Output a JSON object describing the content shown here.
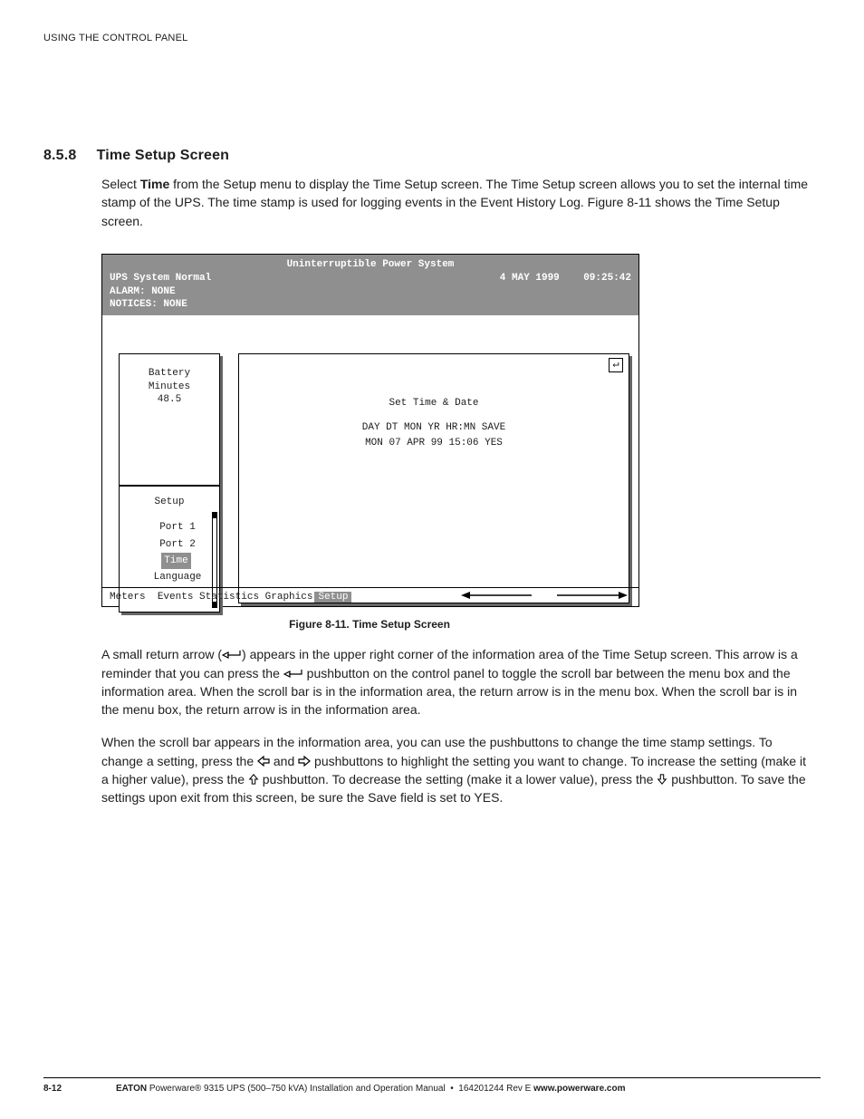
{
  "running_head": "USING THE CONTROL PANEL",
  "section": {
    "num": "8.5.8",
    "title": "Time Setup Screen"
  },
  "intro": {
    "p1a": "Select ",
    "p1_bold": "Time",
    "p1b": " from the Setup menu to display the Time Setup screen. The Time Setup screen allows you to set the internal time stamp of the UPS. The time stamp is used for logging events in the Event History Log. Figure 8-11 shows the Time Setup screen."
  },
  "lcd": {
    "title": "Uninterruptible Power System",
    "status_left": "UPS System Normal",
    "date": "4 MAY 1999",
    "time": "09:25:42",
    "alarm": "ALARM:   NONE",
    "notices": "NOTICES: NONE",
    "battery": {
      "l1": "Battery",
      "l2": "Minutes",
      "l3": "48.5"
    },
    "setup": {
      "header": "Setup",
      "items": [
        "Port 1",
        "Port 2",
        "Time",
        "Language"
      ],
      "selected_index": 2
    },
    "info": {
      "l1": "Set Time & Date",
      "l2": "DAY DT MON YR HR:MN SAVE",
      "l3": "MON 07 APR 99 15:06 YES"
    },
    "nav": {
      "items": [
        "Meters",
        "Events",
        "Statistics",
        "Graphics",
        "Setup"
      ],
      "selected_index": 4
    }
  },
  "fig_caption": "Figure 8-11. Time Setup Screen",
  "para2": {
    "a": "A small return arrow (",
    "b": ") appears in the upper right corner of the information area of the Time Setup screen. This arrow is a reminder that you can press the ",
    "c": " pushbutton on the control panel to toggle the scroll bar between the menu box and the information area. When the scroll bar is in the information area, the return arrow is in the menu box. When the scroll bar is in the menu box, the return arrow is in the information area."
  },
  "para3": {
    "a": "When the scroll bar appears in the information area, you can use the pushbuttons to change the time stamp settings. To change a setting, press the ",
    "b": " and ",
    "c": " pushbuttons to highlight the setting you want to change. To increase the setting (make it a higher value), press the ",
    "d": " pushbutton. To decrease the setting (make it a lower value), press the ",
    "e": " pushbutton. To save the settings upon exit from this screen, be sure the Save field is set to YES."
  },
  "footer": {
    "page": "8-12",
    "brand": "EATON",
    "mid": " Powerware® 9315 UPS (500–750 kVA) Installation and Operation Manual  •  164201244 Rev E ",
    "url": "www.powerware.com"
  }
}
